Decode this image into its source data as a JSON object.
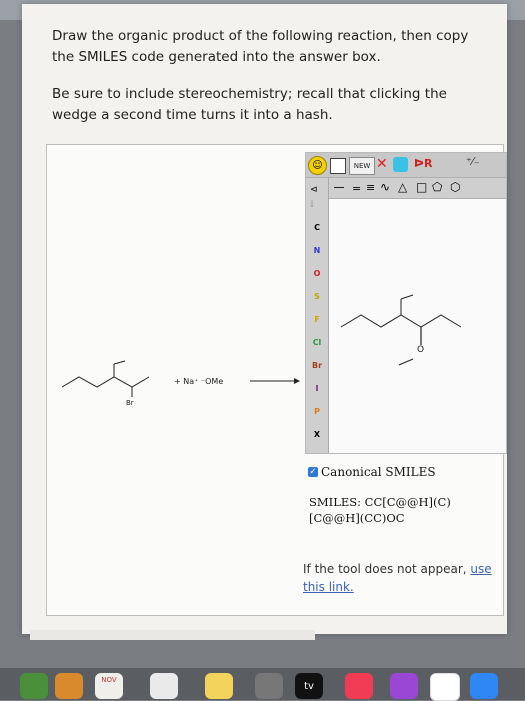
{
  "question": {
    "line1": "Draw the organic product of the following reaction, then copy the SMILES code generated into the answer box.",
    "line2": "Be sure to include stereochemistry; recall that clicking the wedge a second time turns it into a hash."
  },
  "reaction": {
    "reagent": "+ Na⁺ ⁻OMe",
    "halogen_label": "Br"
  },
  "editor": {
    "new_label": "NEW",
    "atoms": [
      "C",
      "N",
      "O",
      "S",
      "F",
      "Cl",
      "Br",
      "I",
      "P",
      "X"
    ],
    "atom_colors": [
      "#222222",
      "#2a3ad8",
      "#d22020",
      "#c9a300",
      "#d8a000",
      "#2a9a3a",
      "#a04020",
      "#7a2080",
      "#d88020",
      "#222222"
    ],
    "product_label": "O"
  },
  "options": {
    "canonical_label": "Canonical SMILES"
  },
  "result": {
    "smiles_label": "SMILES:",
    "smiles_line1": "CC[C@@H](C)",
    "smiles_line2": "[C@@H](CC)OC"
  },
  "fallback": {
    "text": "If the tool does not appear,",
    "link": "use this link."
  },
  "dock": {
    "month": "NOV",
    "tv_label": "tv"
  }
}
